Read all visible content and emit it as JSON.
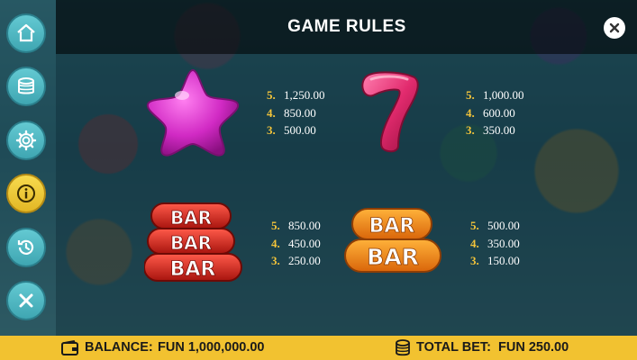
{
  "header": {
    "title": "GAME RULES"
  },
  "sidebar": {
    "items": [
      {
        "icon": "home-icon"
      },
      {
        "icon": "coins-icon"
      },
      {
        "icon": "gear-icon"
      },
      {
        "icon": "info-icon",
        "active": true
      },
      {
        "icon": "history-icon"
      },
      {
        "icon": "close-icon"
      }
    ]
  },
  "paytable": [
    {
      "symbol": "pink-star",
      "rows": [
        {
          "k": "5.",
          "v": "1,250.00"
        },
        {
          "k": "4.",
          "v": "850.00"
        },
        {
          "k": "3.",
          "v": "500.00"
        }
      ]
    },
    {
      "symbol": "red-seven",
      "rows": [
        {
          "k": "5.",
          "v": "1,000.00"
        },
        {
          "k": "4.",
          "v": "600.00"
        },
        {
          "k": "3.",
          "v": "350.00"
        }
      ]
    },
    {
      "symbol": "triple-bar",
      "labels": [
        "BAR",
        "BAR",
        "BAR"
      ],
      "rows": [
        {
          "k": "5.",
          "v": "850.00"
        },
        {
          "k": "4.",
          "v": "450.00"
        },
        {
          "k": "3.",
          "v": "250.00"
        }
      ]
    },
    {
      "symbol": "double-bar",
      "labels": [
        "BAR",
        "BAR"
      ],
      "rows": [
        {
          "k": "5.",
          "v": "500.00"
        },
        {
          "k": "4.",
          "v": "350.00"
        },
        {
          "k": "3.",
          "v": "150.00"
        }
      ]
    }
  ],
  "footer": {
    "balance_label": "BALANCE:",
    "balance_value": "FUN 1,000,000.00",
    "bet_label": "TOTAL BET:",
    "bet_value": "FUN 250.00"
  },
  "colors": {
    "accent": "#f2c230",
    "button": "#4fb8c3",
    "multiplier": "#f3c43a"
  }
}
